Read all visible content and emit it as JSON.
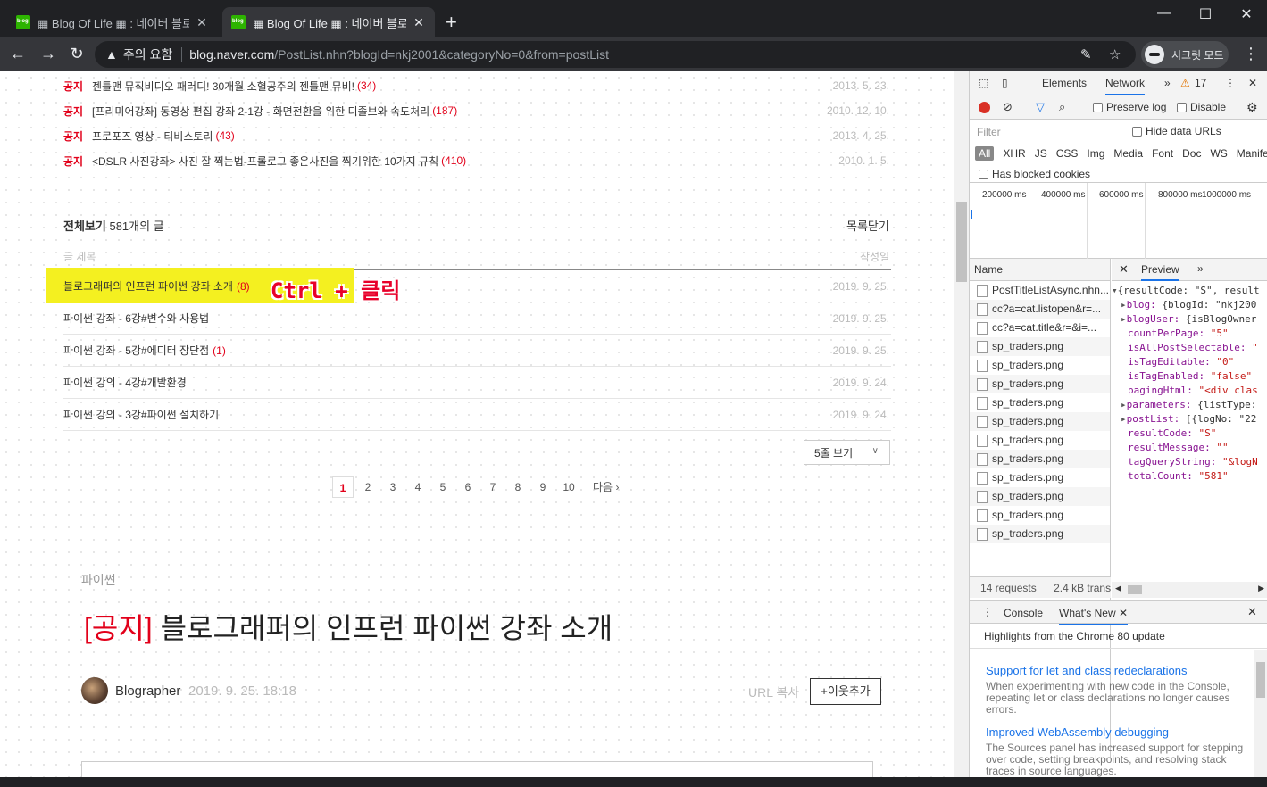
{
  "browser": {
    "tabs": [
      {
        "title": "▦ Blog Of Life ▦ : 네이버 블로그",
        "close": "✕"
      },
      {
        "title": "▦ Blog Of Life ▦ : 네이버 블로그",
        "close": "✕"
      }
    ],
    "new_tab": "+",
    "window_controls": {
      "minimize": "—",
      "maximize": "☐",
      "close": "✕"
    },
    "security_label": "주의 요함",
    "url_host": "blog.naver.com",
    "url_path": "/PostList.nhn?blogId=nkj2001&categoryNo=0&from=postList",
    "incognito_label": "시크릿 모드"
  },
  "notices": [
    {
      "label": "공지",
      "title": "젠틀맨 뮤직비디오 패러디! 30개월 소혈공주의 젠틀맨 뮤비!",
      "count": "(34)",
      "date": "2013. 5. 23."
    },
    {
      "label": "공지",
      "title": "[프리미어강좌] 동영상 편집 강좌 2-1강 - 화면전환을 위한 디졸브와 속도처리",
      "count": "(187)",
      "date": "2010. 12. 10."
    },
    {
      "label": "공지",
      "title": "프로포즈 영상 - 티비스토리",
      "count": "(43)",
      "date": "2013. 4. 25."
    },
    {
      "label": "공지",
      "title": "<DSLR 사진강좌> 사진 잘 찍는법-프롤로그 좋은사진을 찍기위한 10가지 규칙",
      "count": "(410)",
      "date": "2010. 1. 5."
    }
  ],
  "list": {
    "all_label": "전체보기",
    "post_count": "581개의 글",
    "close_label": "목록닫기",
    "col_title": "글 제목",
    "col_date": "작성일",
    "posts": [
      {
        "title": "블로그래퍼의 인프런 파이썬 강좌 소개",
        "count": "(8)",
        "date": "2019. 9. 25."
      },
      {
        "title": "파이썬 강좌 - 6강#변수와 사용법",
        "count": "",
        "date": "2019. 9. 25."
      },
      {
        "title": "파이썬 강좌 - 5강#에디터 장단점",
        "count": "(1)",
        "date": "2019. 9. 25."
      },
      {
        "title": "파이썬 강의 - 4강#개발환경",
        "count": "",
        "date": "2019. 9. 24."
      },
      {
        "title": "파이썬 강의 - 3강#파이썬 설치하기",
        "count": "",
        "date": "2019. 9. 24."
      }
    ],
    "rows_select": "5줄 보기",
    "pages": [
      "1",
      "2",
      "3",
      "4",
      "5",
      "6",
      "7",
      "8",
      "9",
      "10"
    ],
    "next_label": "다음"
  },
  "annotation": "Ctrl + 클릭",
  "post": {
    "category": "파이썬",
    "notice_tag": "[공지]",
    "title": "블로그래퍼의 인프런 파이썬 강좌 소개",
    "author": "Blographer",
    "date": "2019. 9. 25. 18:18",
    "url_copy": "URL 복사",
    "add_neighbor": "+이웃추가"
  },
  "devtools": {
    "tabs": [
      "Elements",
      "Network"
    ],
    "more": "»",
    "warnings": "17",
    "preserve_log": "Preserve log",
    "disable_cache": "Disable",
    "filter_placeholder": "Filter",
    "hide_data_urls": "Hide data URLs",
    "types": [
      "All",
      "XHR",
      "JS",
      "CSS",
      "Img",
      "Media",
      "Font",
      "Doc",
      "WS",
      "Manifest"
    ],
    "blocked_cookies": "Has blocked cookies",
    "timeline_ticks": [
      "200000 ms",
      "400000 ms",
      "600000 ms",
      "800000 ms",
      "1000000 ms"
    ],
    "name_header": "Name",
    "requests": [
      "PostTitleListAsync.nhn...",
      "cc?a=cat.listopen&r=...",
      "cc?a=cat.title&r=&i=...",
      "sp_traders.png",
      "sp_traders.png",
      "sp_traders.png",
      "sp_traders.png",
      "sp_traders.png",
      "sp_traders.png",
      "sp_traders.png",
      "sp_traders.png",
      "sp_traders.png",
      "sp_traders.png",
      "sp_traders.png"
    ],
    "status_requests": "14 requests",
    "status_transferred": "2.4 kB transf",
    "preview_tab": "Preview",
    "preview_lines": [
      {
        "key": "{resultCode: \"S\", result",
        "val": ""
      },
      {
        "key": "blog: ",
        "val": "{blogId: \"nkj200"
      },
      {
        "key": "blogUser: ",
        "val": "{isBlogOwner"
      },
      {
        "key": "countPerPage: ",
        "val": "\"5\""
      },
      {
        "key": "isAllPostSelectable: ",
        "val": "\""
      },
      {
        "key": "isTagEditable: ",
        "val": "\"0\""
      },
      {
        "key": "isTagEnabled: ",
        "val": "\"false\""
      },
      {
        "key": "pagingHtml: ",
        "val": "\"<div clas"
      },
      {
        "key": "parameters: ",
        "val": "{listType:"
      },
      {
        "key": "postList: ",
        "val": "[{logNo: \"22"
      },
      {
        "key": "resultCode: ",
        "val": "\"S\""
      },
      {
        "key": "resultMessage: ",
        "val": "\"\""
      },
      {
        "key": "tagQueryString: ",
        "val": "\"&logN"
      },
      {
        "key": "totalCount: ",
        "val": "\"581\""
      }
    ],
    "console_tab": "Console",
    "whatsnew_tab": "What's New",
    "highlights": "Highlights from the Chrome 80 update",
    "whatsnew": [
      {
        "title": "Support for let and class redeclarations",
        "body": "When experimenting with new code in the Console, repeating let or class declarations no longer causes errors."
      },
      {
        "title": "Improved WebAssembly debugging",
        "body": "The Sources panel has increased support for stepping over code, setting breakpoints, and resolving stack traces in source languages."
      }
    ]
  }
}
